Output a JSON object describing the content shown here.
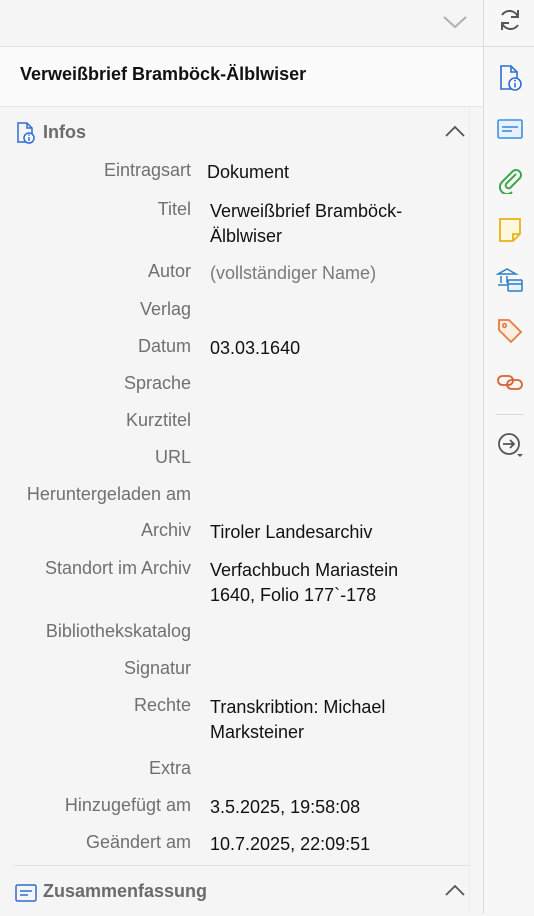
{
  "item_title": "Verweißbrief Bramböck-Älblwiser",
  "sections": {
    "infos": "Infos",
    "summary": "Zusammenfassung"
  },
  "fields": {
    "item_type": {
      "label": "Eintragsart",
      "value": "Dokument"
    },
    "title": {
      "label": "Titel",
      "value_line1": "Verweißbrief Bramböck-",
      "value_line2": "Älblwiser"
    },
    "author": {
      "label": "Autor",
      "placeholder": "(vollständiger Name)"
    },
    "publisher": {
      "label": "Verlag",
      "value": ""
    },
    "date": {
      "label": "Datum",
      "value": "03.03.1640"
    },
    "language": {
      "label": "Sprache",
      "value": ""
    },
    "short_title": {
      "label": "Kurztitel",
      "value": ""
    },
    "url": {
      "label": "URL",
      "value": ""
    },
    "accessed": {
      "label": "Heruntergeladen am",
      "value": ""
    },
    "archive": {
      "label": "Archiv",
      "value": "Tiroler Landesarchiv"
    },
    "archive_location": {
      "label": "Standort im Archiv",
      "value_line1": "Verfachbuch Mariastein",
      "value_line2": "1640, Folio 177`-178"
    },
    "library_catalog": {
      "label": "Bibliothekskatalog",
      "value": ""
    },
    "call_number": {
      "label": "Signatur",
      "value": ""
    },
    "rights": {
      "label": "Rechte",
      "value_line1": "Transkribtion: Michael",
      "value_line2": "Marksteiner"
    },
    "extra": {
      "label": "Extra",
      "value": ""
    },
    "date_added": {
      "label": "Hinzugefügt am",
      "value": "3.5.2025, 19:58:08"
    },
    "date_modified": {
      "label": "Geändert am",
      "value": "10.7.2025, 22:09:51"
    }
  },
  "sidenav_icons": [
    "refresh-icon",
    "info-icon",
    "abstract-icon",
    "attachment-icon",
    "note-icon",
    "libraries-collections-icon",
    "tag-icon",
    "related-icon",
    "locate-icon"
  ],
  "colors": {
    "accent": "#2f6fd0",
    "green": "#3ea64a",
    "yellow": "#e8b215",
    "orange": "#e57a3c"
  }
}
